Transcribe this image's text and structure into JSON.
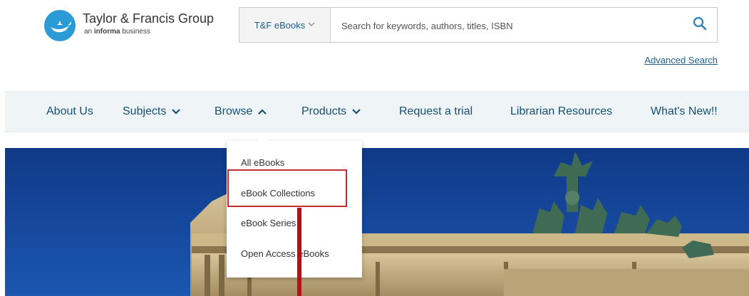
{
  "header": {
    "logo_name": "Taylor & Francis Group",
    "logo_tag_prefix": "an ",
    "logo_tag_bold": "informa",
    "logo_tag_suffix": " business",
    "search_scope": "T&F eBooks",
    "search_placeholder": "Search for keywords, authors, titles, ISBN",
    "search_value": "",
    "advanced_search": "Advanced Search"
  },
  "nav": {
    "items": [
      {
        "label": "About Us",
        "chevron": "none"
      },
      {
        "label": "Subjects",
        "chevron": "down"
      },
      {
        "label": "Browse",
        "chevron": "up"
      },
      {
        "label": "Products",
        "chevron": "down"
      },
      {
        "label": "Request a trial",
        "chevron": "none"
      },
      {
        "label": "Librarian Resources",
        "chevron": "none"
      },
      {
        "label": "What's New!!",
        "chevron": "none"
      }
    ]
  },
  "dropdown": {
    "items": [
      {
        "label": "All eBooks"
      },
      {
        "label": "eBook Collections",
        "highlighted": true
      },
      {
        "label": "eBook Series"
      },
      {
        "label": "Open Access eBooks"
      }
    ]
  },
  "hero": {
    "image": "brandenburg-gate-quadriga"
  },
  "colors": {
    "nav_text": "#154f73",
    "nav_bg": "#eff5f7",
    "logo_blue": "#2b9bd6",
    "highlight": "#c62b2b",
    "sky": "#123f8f"
  },
  "icons": {
    "search": "search-icon",
    "scope_chevron": "chevron-down-icon"
  }
}
